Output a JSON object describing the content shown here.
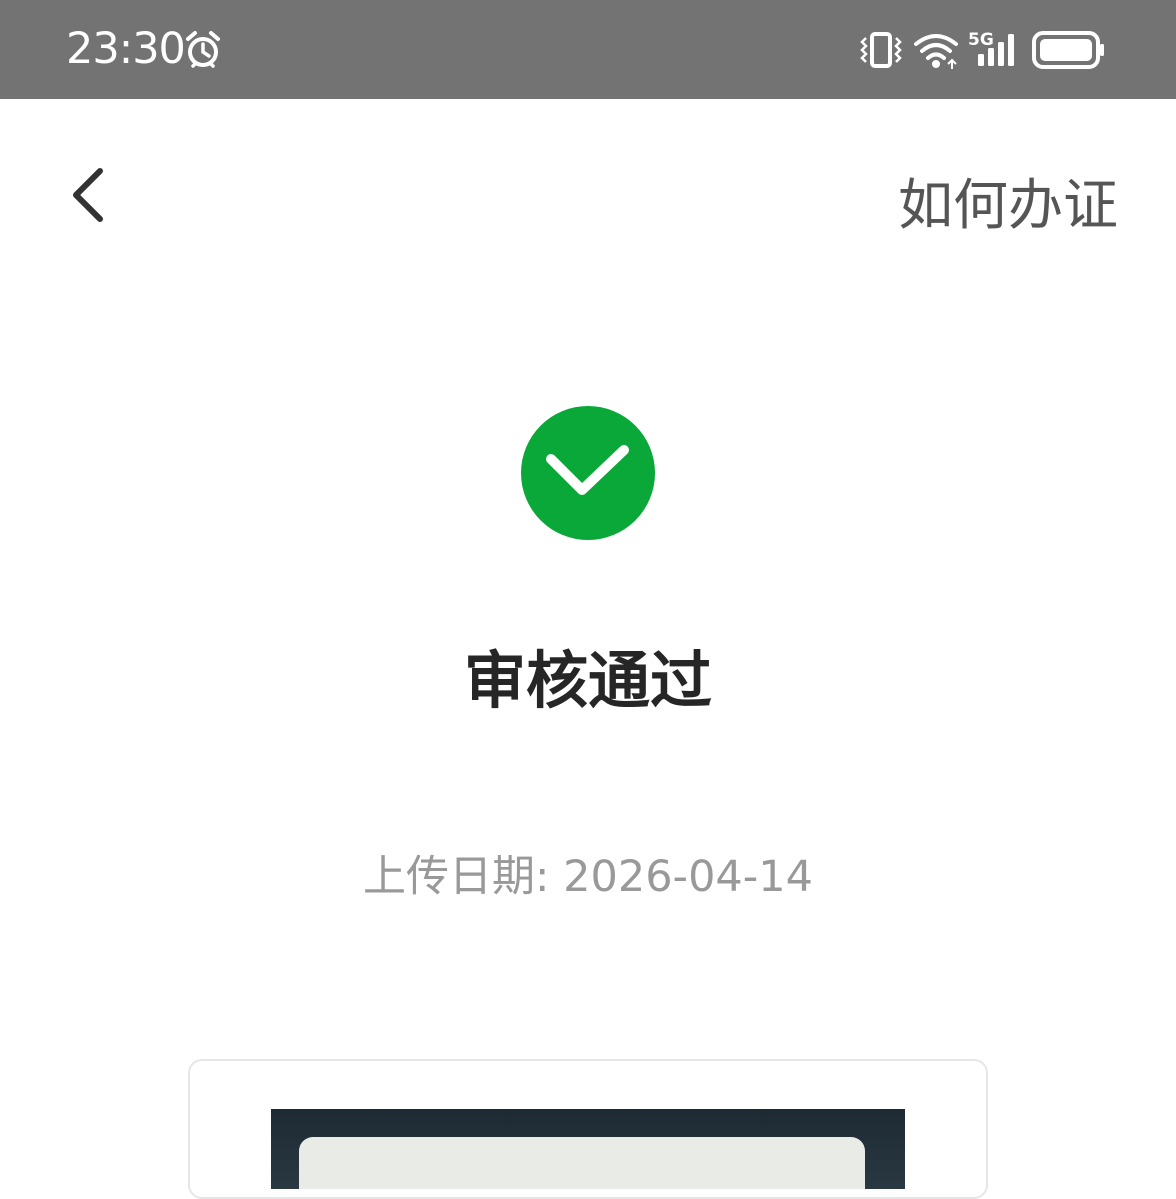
{
  "status_bar": {
    "time": "23:30",
    "icons": [
      "alarm-icon",
      "vibrate-icon",
      "wifi-icon",
      "signal-5g-icon",
      "battery-icon"
    ],
    "network_label": "5G"
  },
  "header": {
    "back_icon": "chevron-left-icon",
    "help_label": "如何办证"
  },
  "result": {
    "icon": "check-circle-icon",
    "title": "审核通过",
    "upload_date": "上传日期: 2026-04-14"
  },
  "colors": {
    "status_bar": "#737373",
    "success": "#0aa838",
    "title": "#262626",
    "muted": "#999999",
    "link": "#555555"
  }
}
